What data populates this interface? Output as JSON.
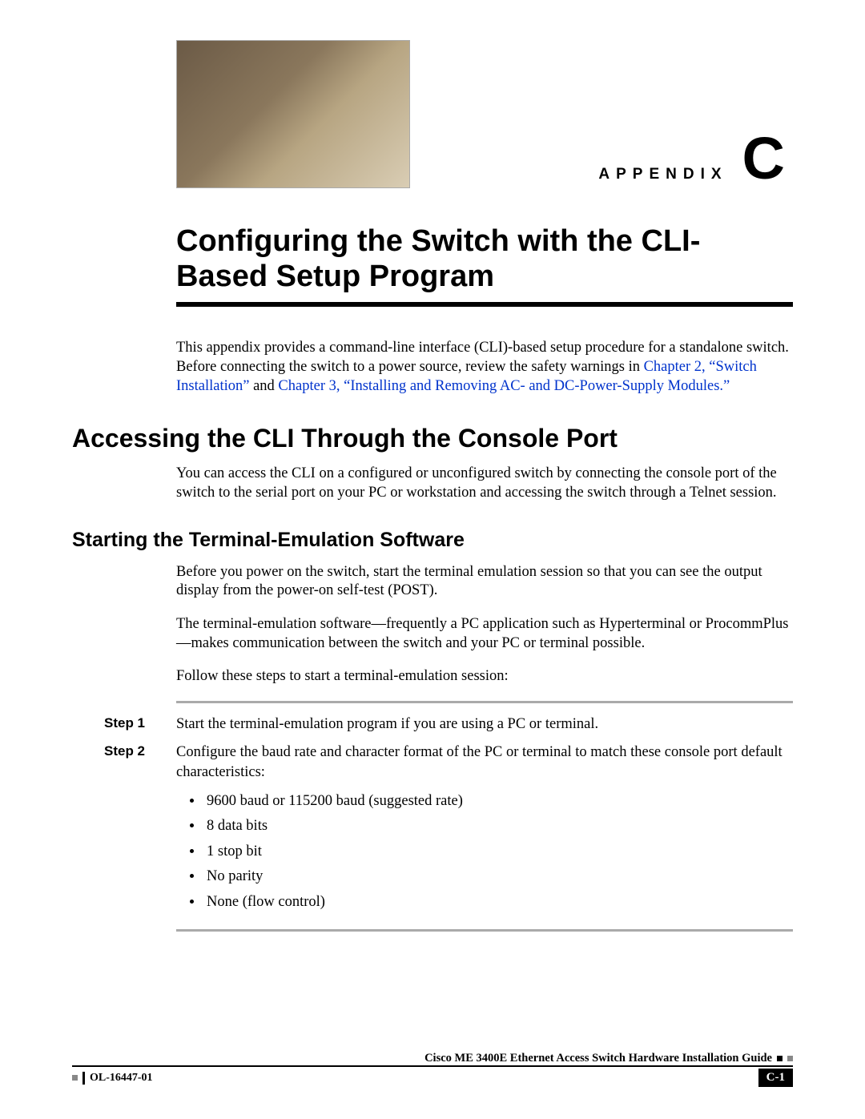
{
  "header": {
    "appendix_word": "APPENDIX",
    "appendix_letter": "C"
  },
  "title": "Configuring the Switch with the CLI-Based Setup Program",
  "intro": {
    "p1a": "This appendix provides a command-line interface (CLI)-based setup procedure for a standalone switch. Before connecting the switch to a power source, review the safety warnings in ",
    "link1": "Chapter 2, “Switch Installation”",
    "p1b": " and ",
    "link2": "Chapter 3, “Installing and Removing AC- and DC-Power-Supply Modules.”"
  },
  "section1": {
    "heading": "Accessing the CLI Through the Console Port",
    "p1": "You can access the CLI on a configured or unconfigured switch by connecting the console port of the switch to the serial port on your PC or workstation and accessing the switch through a Telnet session."
  },
  "section2": {
    "heading": "Starting the Terminal-Emulation Software",
    "p1": "Before you power on the switch, start the terminal emulation session so that you can see the output display from the power-on self-test (POST).",
    "p2": "The terminal-emulation software—frequently a PC application such as Hyperterminal or ProcommPlus—makes communication between the switch and your PC or terminal possible.",
    "p3": "Follow these steps to start a terminal-emulation session:"
  },
  "steps": [
    {
      "label": "Step 1",
      "text": "Start the terminal-emulation program if you are using a PC or terminal."
    },
    {
      "label": "Step 2",
      "text": "Configure the baud rate and character format of the PC or terminal to match these console port default characteristics:"
    }
  ],
  "bullets": [
    "9600 baud or 115200 baud (suggested rate)",
    "8 data bits",
    "1 stop bit",
    "No parity",
    "None (flow control)"
  ],
  "footer": {
    "guide": "Cisco ME 3400E Ethernet Access Switch Hardware Installation Guide",
    "docnum": "OL-16447-01",
    "page": "C-1"
  }
}
